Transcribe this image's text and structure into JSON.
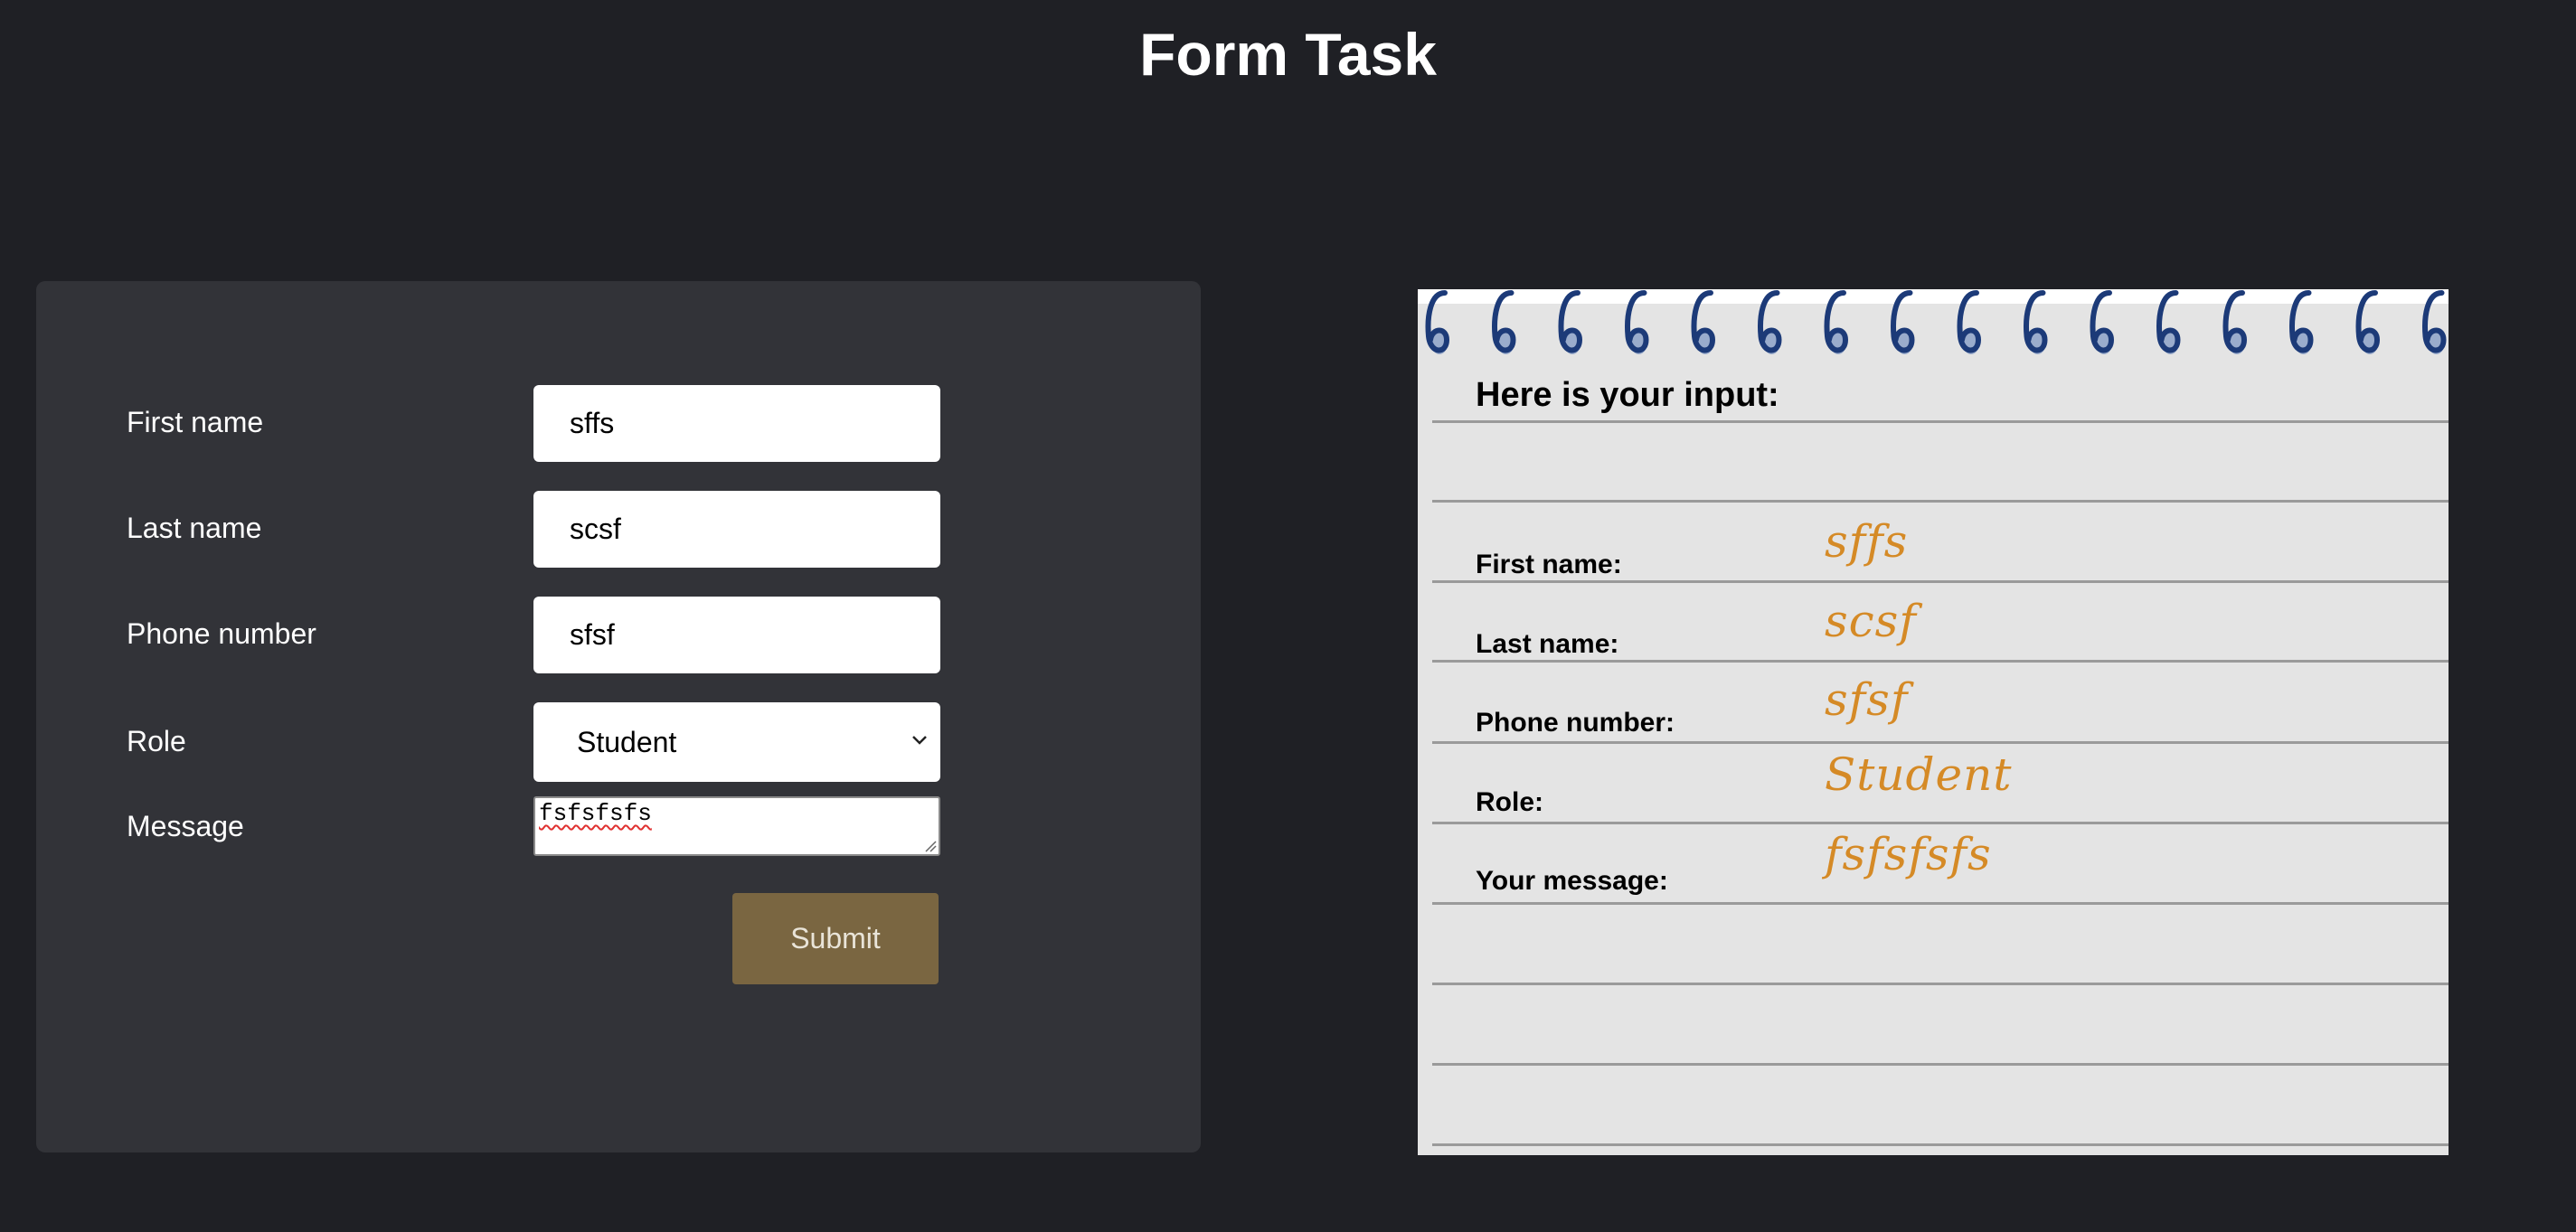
{
  "page": {
    "title": "Form Task"
  },
  "form": {
    "fields": [
      {
        "label": "First name",
        "value": "sffs"
      },
      {
        "label": "Last name",
        "value": "scsf"
      },
      {
        "label": "Phone number",
        "value": "sfsf"
      }
    ],
    "role": {
      "label": "Role",
      "selected": "Student"
    },
    "message": {
      "label": "Message",
      "value": "fsfsfsfs"
    },
    "submit_label": "Submit"
  },
  "notebook": {
    "heading": "Here is your input:",
    "rows": [
      {
        "label": "First name:",
        "value": "sffs"
      },
      {
        "label": "Last name:",
        "value": "scsf"
      },
      {
        "label": "Phone number:",
        "value": "sfsf"
      },
      {
        "label": "Role:",
        "value": "Student"
      },
      {
        "label": "Your message:",
        "value": "fsfsfsfs"
      }
    ]
  },
  "colors": {
    "background": "#1f2025",
    "card": "#323338",
    "submit": "#7a6641",
    "notebook_paper": "#e4e4e4",
    "spiral": "#1c3a78",
    "handwriting": "#d58a26"
  },
  "icons": {
    "select_chevron": "chevron-down-icon",
    "resize": "resize-grip-icon",
    "spiral": "spiral-binding-icon"
  }
}
